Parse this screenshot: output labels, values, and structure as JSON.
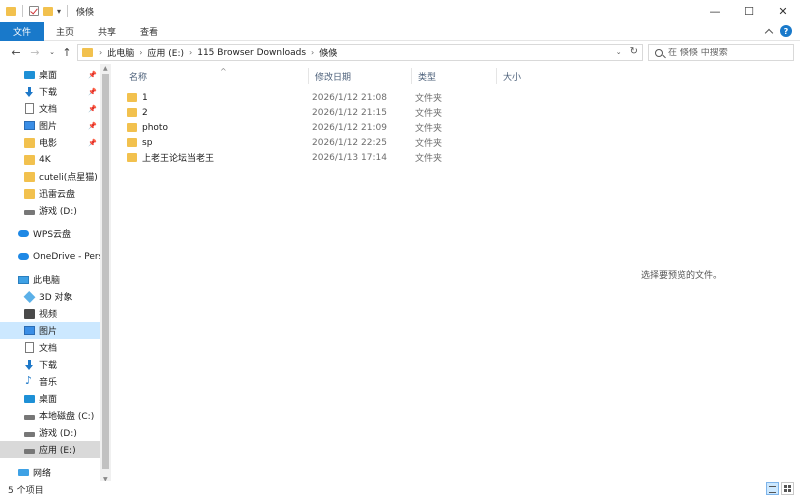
{
  "window": {
    "title": "倏倏",
    "controls": {
      "minimize": "—",
      "maximize": "☐",
      "close": "✕"
    }
  },
  "ribbon": {
    "tabs": [
      {
        "label": "文件"
      },
      {
        "label": "主页"
      },
      {
        "label": "共享"
      },
      {
        "label": "查看"
      }
    ],
    "help": "?"
  },
  "address": {
    "crumbs": [
      "此电脑",
      "应用 (E:)",
      "115 Browser Downloads",
      "倏倏"
    ]
  },
  "search": {
    "placeholder": "在 倏倏 中搜索"
  },
  "nav": {
    "items": [
      {
        "label": "桌面",
        "icon": "desktop-icon",
        "pinned": true
      },
      {
        "label": "下载",
        "icon": "download-icon",
        "pinned": true
      },
      {
        "label": "文档",
        "icon": "document-icon",
        "pinned": true
      },
      {
        "label": "图片",
        "icon": "picture-icon",
        "pinned": true
      },
      {
        "label": "电影",
        "icon": "folder-icon",
        "pinned": true
      },
      {
        "label": "4K",
        "icon": "folder-icon"
      },
      {
        "label": "cuteli(点星猫)",
        "icon": "folder-icon"
      },
      {
        "label": "迅雷云盘",
        "icon": "folder-icon"
      },
      {
        "label": "游戏 (D:)",
        "icon": "drive-icon"
      },
      {
        "label": "WPS云盘",
        "icon": "cloud-icon"
      },
      {
        "label": "OneDrive - Personal",
        "icon": "onedrive-icon"
      },
      {
        "label": "此电脑",
        "icon": "computer-icon"
      },
      {
        "label": "3D 对象",
        "icon": "3d-objects-icon"
      },
      {
        "label": "视频",
        "icon": "video-icon"
      },
      {
        "label": "图片",
        "icon": "picture-icon"
      },
      {
        "label": "文档",
        "icon": "document-icon"
      },
      {
        "label": "下载",
        "icon": "download-icon"
      },
      {
        "label": "音乐",
        "icon": "music-icon"
      },
      {
        "label": "桌面",
        "icon": "desktop-icon"
      },
      {
        "label": "本地磁盘 (C:)",
        "icon": "drive-icon"
      },
      {
        "label": "游戏 (D:)",
        "icon": "drive-icon"
      },
      {
        "label": "应用 (E:)",
        "icon": "drive-icon"
      },
      {
        "label": "网络",
        "icon": "network-icon"
      }
    ]
  },
  "columns": {
    "name": "名称",
    "date": "修改日期",
    "type": "类型",
    "size": "大小"
  },
  "files": [
    {
      "name": "1",
      "date": "2026/1/12 21:08",
      "type": "文件夹"
    },
    {
      "name": "2",
      "date": "2026/1/12 21:15",
      "type": "文件夹"
    },
    {
      "name": "photo",
      "date": "2026/1/12 21:09",
      "type": "文件夹"
    },
    {
      "name": "sp",
      "date": "2026/1/12 22:25",
      "type": "文件夹"
    },
    {
      "name": "上老王论坛当老王",
      "date": "2026/1/13 17:14",
      "type": "文件夹"
    }
  ],
  "preview": {
    "message": "选择要预览的文件。"
  },
  "status": {
    "count": "5 个项目"
  },
  "colors": {
    "accent": "#1979ca",
    "folder": "#f2c14e",
    "selection": "#cce8ff"
  }
}
